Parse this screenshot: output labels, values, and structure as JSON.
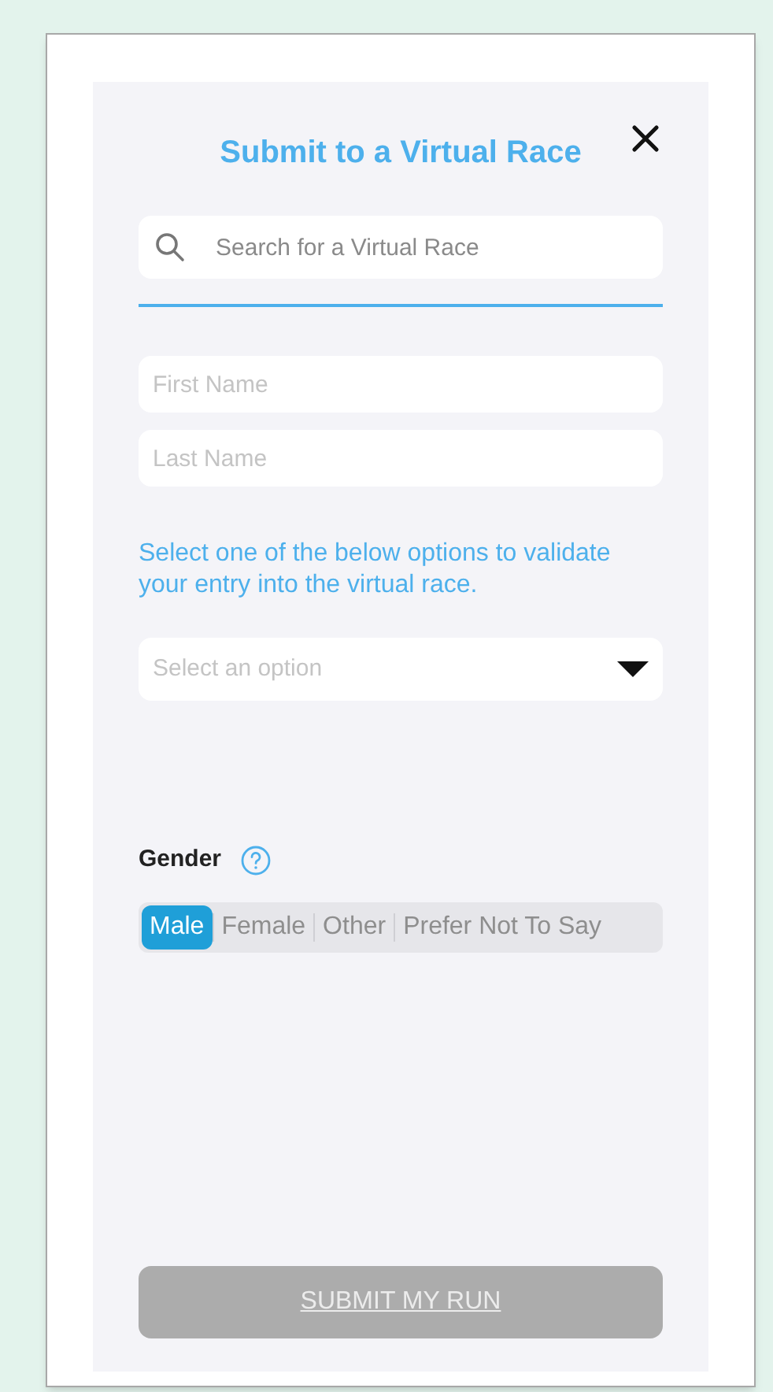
{
  "title": "Submit to a Virtual Race",
  "search": {
    "placeholder": "Search for a Virtual Race"
  },
  "first_name": {
    "placeholder": "First Name"
  },
  "last_name": {
    "placeholder": "Last Name"
  },
  "instructions": "Select one of the below options to validate your entry into the virtual race.",
  "option_select": {
    "placeholder": "Select an option"
  },
  "gender": {
    "label": "Gender",
    "options": [
      {
        "label": "Male",
        "selected": true
      },
      {
        "label": "Female",
        "selected": false
      },
      {
        "label": "Other",
        "selected": false
      },
      {
        "label": "Prefer Not To Say",
        "selected": false
      }
    ]
  },
  "submit_button": {
    "label": "SUBMIT MY RUN",
    "disabled": true
  }
}
